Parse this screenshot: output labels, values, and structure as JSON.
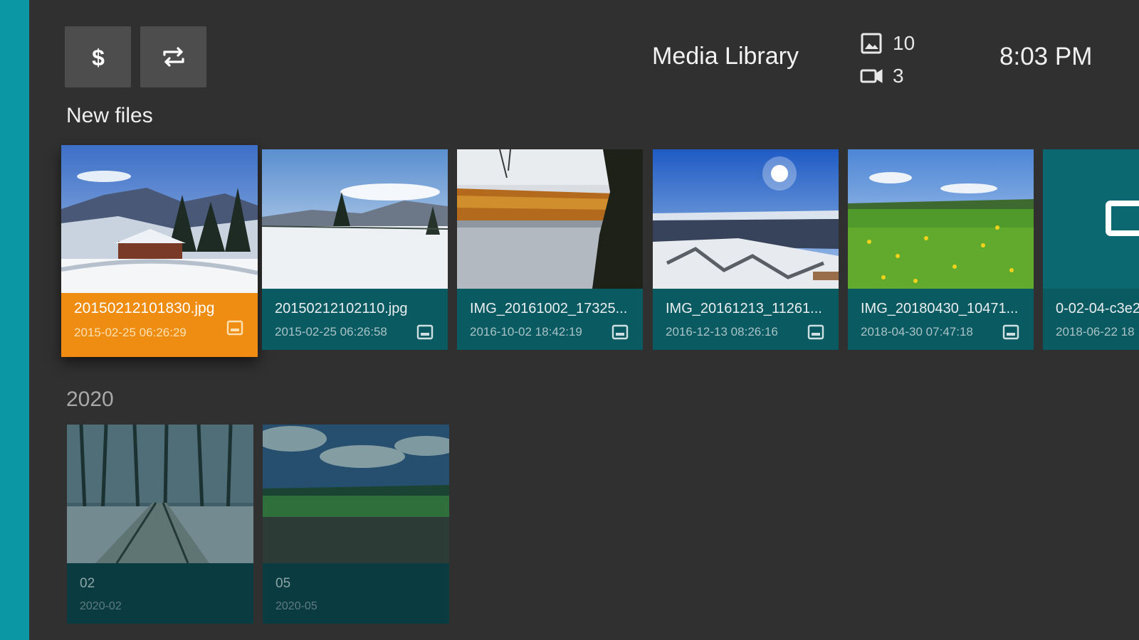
{
  "app": {
    "title": "Media Library",
    "clock": "8:03 PM"
  },
  "toolbar": {
    "dollar_icon": "dollar-icon",
    "swap_icon": "swap-arrows-icon"
  },
  "counts": {
    "images": "10",
    "videos": "3",
    "image_icon": "image-icon",
    "video_icon": "video-camera-icon"
  },
  "sections": {
    "new_files": "New files",
    "year": "2020"
  },
  "new_files": [
    {
      "name": "20150212101830.jpg",
      "date": "2015-02-25 06:26:29",
      "icon": "image-icon",
      "selected": true
    },
    {
      "name": "20150212102110.jpg",
      "date": "2015-02-25 06:26:58",
      "icon": "image-icon"
    },
    {
      "name": "IMG_20161002_17325...",
      "date": "2016-10-02 18:42:19",
      "icon": "image-icon"
    },
    {
      "name": "IMG_20161213_11261...",
      "date": "2016-12-13 08:26:16",
      "icon": "image-icon"
    },
    {
      "name": "IMG_20180430_10471...",
      "date": "2018-04-30 07:47:18",
      "icon": "image-icon"
    },
    {
      "name": "0-02-04-c3e2",
      "date": "2018-06-22 18",
      "icon": "video-icon"
    }
  ],
  "folders": [
    {
      "name": "02",
      "date": "2020-02"
    },
    {
      "name": "05",
      "date": "2020-05"
    }
  ],
  "colors": {
    "accent": "#0b97a3",
    "selected": "#ef8d12",
    "card": "#0a5a62",
    "background": "#303030"
  }
}
